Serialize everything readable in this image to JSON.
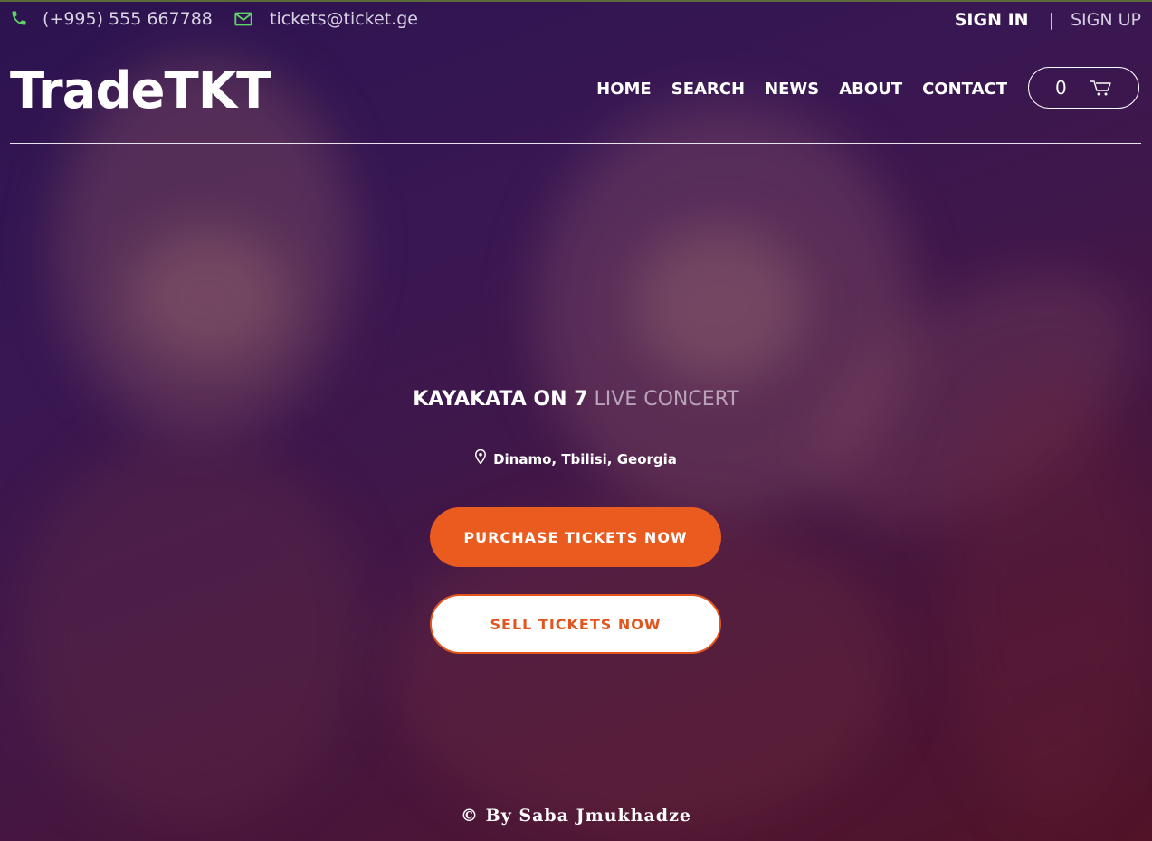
{
  "contact": {
    "phone": "(+995) 555 667788",
    "email": "tickets@ticket.ge",
    "phone_icon": "phone-icon",
    "email_icon": "mail-icon"
  },
  "auth": {
    "signin_label": "SIGN IN",
    "separator": "|",
    "signup_label": "SIGN UP"
  },
  "header": {
    "logo": "TradeTKT",
    "nav": [
      "HOME",
      "SEARCH",
      "NEWS",
      "ABOUT",
      "CONTACT"
    ],
    "cart_count": "0",
    "cart_icon": "cart-icon"
  },
  "hero": {
    "title_strong": "KAYAKATA ON 7",
    "title_light": "LIVE CONCERT",
    "location": "Dinamo, Tbilisi, Georgia",
    "location_icon": "map-pin-icon",
    "purchase_label": "PURCHASE TICKETS NOW",
    "sell_label": "SELL TICKETS NOW"
  },
  "footer": {
    "credit": "© By Saba Jmukhadze"
  },
  "colors": {
    "accent": "#ea5b1f",
    "icon_green": "#5fd36a",
    "text_white": "#ffffff"
  }
}
